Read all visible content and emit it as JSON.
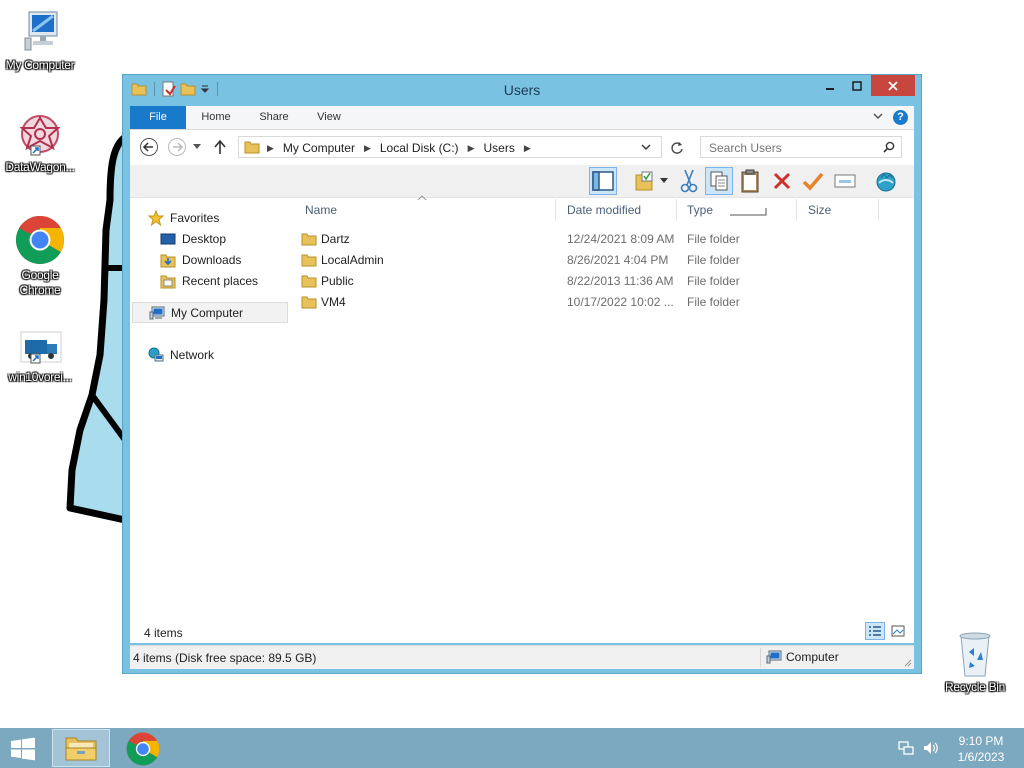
{
  "desktop": {
    "icons": [
      {
        "label": "My Computer",
        "icon": "computer-icon"
      },
      {
        "label": "DataWagon...",
        "icon": "datawagon-shortcut-icon"
      },
      {
        "label": "Google Chrome",
        "icon": "chrome-icon"
      },
      {
        "label": "win10vorei...",
        "icon": "truck-shortcut-icon"
      },
      {
        "label": "Recycle Bin",
        "icon": "recycle-bin-icon"
      }
    ]
  },
  "window": {
    "title": "Users",
    "ribbon_tabs": [
      "File",
      "Home",
      "Share",
      "View"
    ],
    "breadcrumb": [
      "My Computer",
      "Local Disk (C:)",
      "Users"
    ],
    "search_placeholder": "Search Users",
    "nav_pane": {
      "favorites": "Favorites",
      "favorites_items": [
        "Desktop",
        "Downloads",
        "Recent places"
      ],
      "my_computer": "My Computer",
      "network": "Network"
    },
    "columns": [
      "Name",
      "Date modified",
      "Type",
      "Size"
    ],
    "files": [
      {
        "name": "Dartz",
        "date": "12/24/2021 8:09 AM",
        "type": "File folder"
      },
      {
        "name": "LocalAdmin",
        "date": "8/26/2021 4:04 PM",
        "type": "File folder"
      },
      {
        "name": "Public",
        "date": "8/22/2013 11:36 AM",
        "type": "File folder"
      },
      {
        "name": "VM4",
        "date": "10/17/2022 10:02 ...",
        "type": "File folder"
      }
    ],
    "item_count": "4 items",
    "status_text": "4 items (Disk free space: 89.5 GB)",
    "status_location": "Computer"
  },
  "taskbar": {
    "time": "9:10 PM",
    "date": "1/6/2023"
  },
  "colors": {
    "window_frame": "#7ac2e1",
    "file_tab": "#1979ca",
    "close_button": "#c7463e",
    "taskbar": "#7ca8c0",
    "folder": "#e8c15a"
  }
}
